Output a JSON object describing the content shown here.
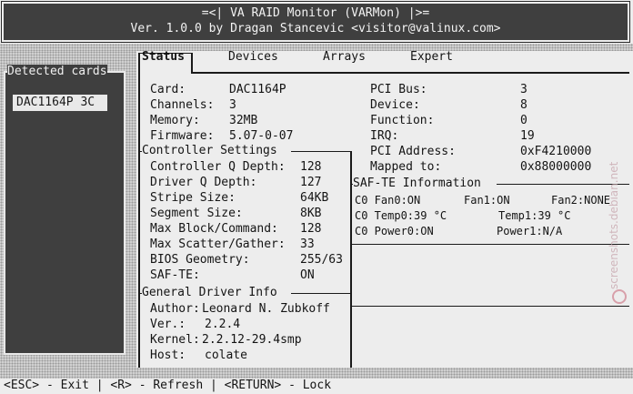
{
  "window": {
    "title": "=<| VA RAID Monitor (VARMon) |>=",
    "subtitle": "Ver. 1.0.0 by Dragan Stancevic <visitor@valinux.com>"
  },
  "sidebar": {
    "title": "Detected cards",
    "items": [
      "DAC1164P 3C"
    ]
  },
  "tabs": [
    {
      "label": "Status",
      "active": true
    },
    {
      "label": "Devices",
      "active": false
    },
    {
      "label": "Arrays",
      "active": false
    },
    {
      "label": "Expert",
      "active": false
    }
  ],
  "card_info": [
    {
      "label": "Card:",
      "value": "DAC1164P"
    },
    {
      "label": "Channels:",
      "value": "3"
    },
    {
      "label": "Memory:",
      "value": "32MB"
    },
    {
      "label": "Firmware:",
      "value": "5.07-0-07"
    }
  ],
  "pci_info": [
    {
      "label": "PCI Bus:",
      "value": "3"
    },
    {
      "label": "Device:",
      "value": "8"
    },
    {
      "label": "Function:",
      "value": "0"
    },
    {
      "label": "IRQ:",
      "value": "19"
    },
    {
      "label": "PCI Address:",
      "value": "0xF4210000"
    },
    {
      "label": "Mapped to:",
      "value": "0x88000000"
    }
  ],
  "controller_settings": {
    "title": "Controller Settings",
    "rows": [
      {
        "label": "Controller Q Depth:",
        "value": "128"
      },
      {
        "label": "Driver Q Depth:",
        "value": "127"
      },
      {
        "label": "Stripe Size:",
        "value": "64KB"
      },
      {
        "label": "Segment Size:",
        "value": "8KB"
      },
      {
        "label": "Max Block/Command:",
        "value": "128"
      },
      {
        "label": "Max Scatter/Gather:",
        "value": "33"
      },
      {
        "label": "BIOS Geometry:",
        "value": "255/63"
      },
      {
        "label": "SAF-TE:",
        "value": "ON"
      }
    ]
  },
  "saf_te": {
    "title": "SAF-TE Information",
    "lines": [
      [
        "C0 Fan0:ON",
        "Fan1:ON",
        "Fan2:NONE"
      ],
      [
        "C0 Temp0:39 °C",
        "Temp1:39 °C",
        ""
      ],
      [
        "C0 Power0:ON",
        "Power1:N/A",
        ""
      ]
    ]
  },
  "driver_info": {
    "title": "General Driver Info",
    "rows": [
      {
        "label": "Author:",
        "value": "Leonard N. Zubkoff"
      },
      {
        "label": "Ver.:",
        "value": "2.2.4"
      },
      {
        "label": "Kernel:",
        "value": "2.2.12-29.4smp"
      },
      {
        "label": "Host:",
        "value": "colate"
      }
    ]
  },
  "status_bar": "<ESC> - Exit | <R> - Refresh | <RETURN> - Lock",
  "watermark": "screenshots.debian.net"
}
